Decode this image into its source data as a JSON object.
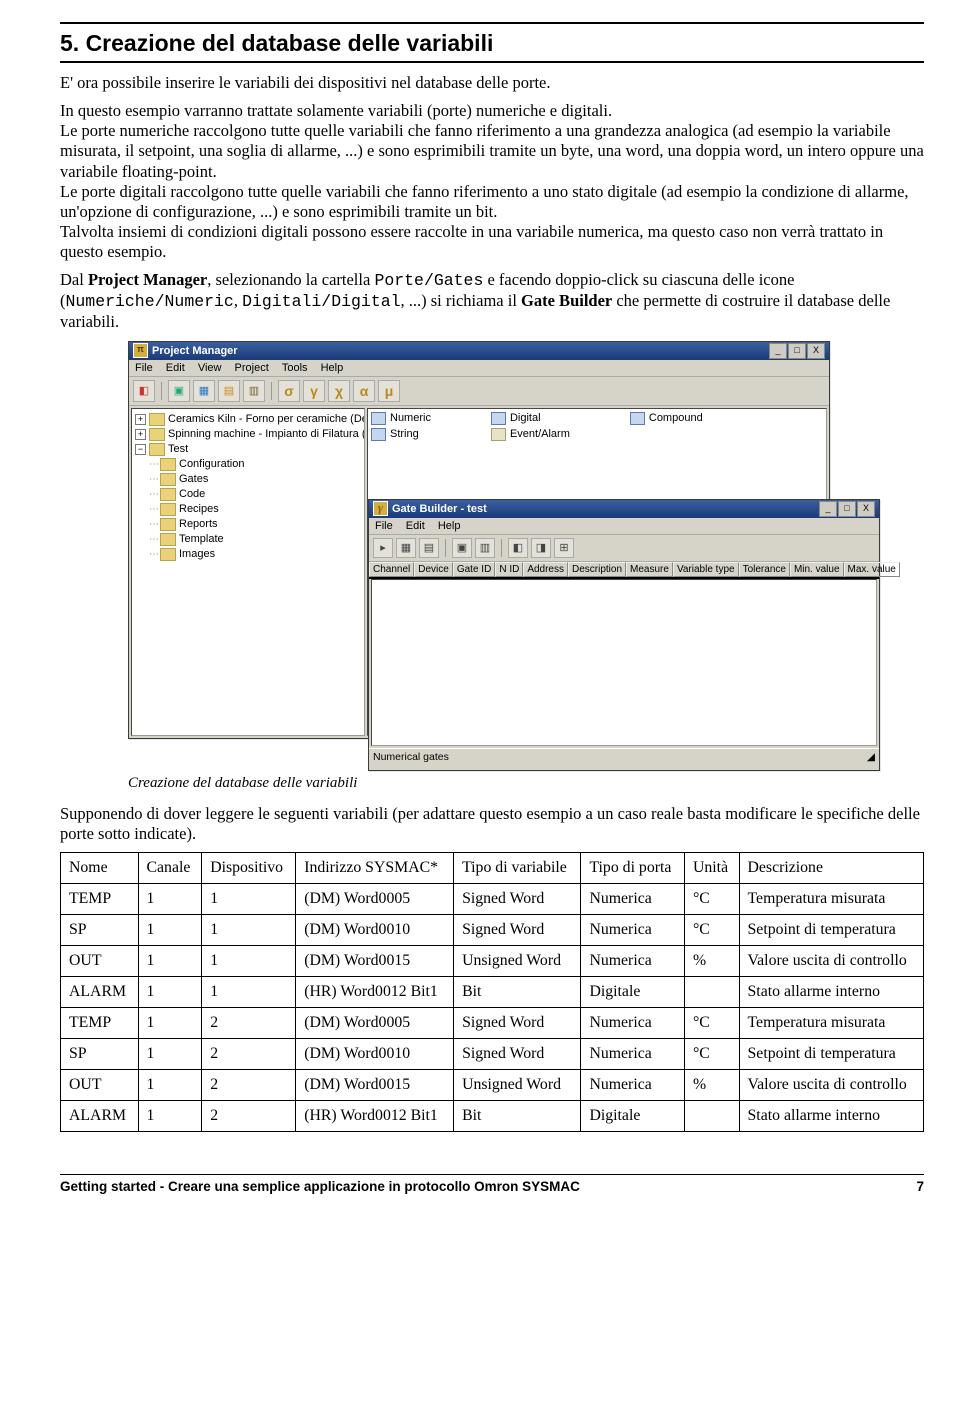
{
  "heading": "5. Creazione del database delle variabili",
  "para1": "E' ora possibile inserire le variabili dei dispositivi nel database delle porte.",
  "para2": "In questo esempio varranno trattate solamente variabili (porte) numeriche e digitali.",
  "para2b": "Le porte numeriche raccolgono tutte quelle variabili che fanno riferimento a una grandezza analogica (ad esempio la variabile misurata, il setpoint, una soglia di allarme, ...) e sono esprimibili tramite un byte, una word, una doppia word, un intero oppure una variabile floating-point.",
  "para2c": "Le porte digitali raccolgono tutte quelle variabili che fanno riferimento a uno stato digitale (ad esempio la condizione di allarme, un'opzione di configurazione, ...) e sono esprimibili tramite un bit.",
  "para2d": "Talvolta insiemi di condizioni digitali possono essere raccolte in una variabile numerica, ma questo caso non verrà trattato in questo esempio.",
  "para3a": "Dal ",
  "para3b_bold": "Project Manager",
  "para3c": ", selezionando la cartella ",
  "para3d_mono": "Porte/Gates",
  "para3e": " e facendo doppio-click su ciascuna delle icone (",
  "para3f_mono": "Numeriche/Numeric",
  "para3g": ", ",
  "para3h_mono": "Digitali/Digital",
  "para3i": ", ...) si richiama il ",
  "para3j_bold": "Gate Builder",
  "para3k": " che permette di costruire il database delle variabili.",
  "pm": {
    "icon": "π",
    "title": "Project Manager",
    "menu": [
      "File",
      "Edit",
      "View",
      "Project",
      "Tools",
      "Help"
    ],
    "greek": [
      "σ",
      "γ",
      "χ",
      "α",
      "μ"
    ],
    "tree": [
      {
        "exp": "+",
        "label": "Ceramics Kiln - Forno per ceramiche (Demo)"
      },
      {
        "exp": "+",
        "label": "Spinning machine - Impianto di Filatura (Demo)"
      },
      {
        "exp": "−",
        "label": "Test"
      }
    ],
    "subtree": [
      "Configuration",
      "Gates",
      "Code",
      "Recipes",
      "Reports",
      "Template",
      "Images"
    ],
    "right_col1": [
      "Numeric",
      "String"
    ],
    "right_col2": [
      "Digital",
      "Event/Alarm"
    ],
    "right_col3": [
      "Compound"
    ]
  },
  "gb": {
    "icon": "γ",
    "title": "Gate Builder - test",
    "menu": [
      "File",
      "Edit",
      "Help"
    ],
    "cols": [
      "Channel",
      "Device",
      "Gate ID",
      "N ID",
      "Address",
      "Description",
      "Measure",
      "Variable type",
      "Tolerance",
      "Min. value",
      "Max. value"
    ],
    "status": "Numerical gates"
  },
  "caption": "Creazione del database delle variabili",
  "para4": "Supponendo di dover leggere le seguenti variabili (per adattare questo esempio a un caso reale basta modificare le specifiche delle porte sotto indicate).",
  "thead": [
    "Nome",
    "Canale",
    "Dispositivo",
    "Indirizzo SYSMAC*",
    "Tipo di variabile",
    "Tipo di porta",
    "Unità",
    "Descrizione"
  ],
  "rows": [
    [
      "TEMP",
      "1",
      "1",
      "(DM) Word0005",
      "Signed Word",
      "Numerica",
      "°C",
      "Temperatura misurata"
    ],
    [
      "SP",
      "1",
      "1",
      "(DM) Word0010",
      "Signed Word",
      "Numerica",
      "°C",
      "Setpoint di temperatura"
    ],
    [
      "OUT",
      "1",
      "1",
      "(DM) Word0015",
      "Unsigned Word",
      "Numerica",
      "%",
      "Valore uscita di controllo"
    ],
    [
      "ALARM",
      "1",
      "1",
      "(HR) Word0012 Bit1",
      "Bit",
      "Digitale",
      "",
      "Stato allarme interno"
    ],
    [
      "TEMP",
      "1",
      "2",
      "(DM) Word0005",
      "Signed Word",
      "Numerica",
      "°C",
      "Temperatura misurata"
    ],
    [
      "SP",
      "1",
      "2",
      "(DM) Word0010",
      "Signed Word",
      "Numerica",
      "°C",
      "Setpoint di temperatura"
    ],
    [
      "OUT",
      "1",
      "2",
      "(DM) Word0015",
      "Unsigned Word",
      "Numerica",
      "%",
      "Valore uscita di controllo"
    ],
    [
      "ALARM",
      "1",
      "2",
      "(HR) Word0012 Bit1",
      "Bit",
      "Digitale",
      "",
      "Stato allarme interno"
    ]
  ],
  "footer_left": "Getting started - Creare una semplice applicazione in protocollo Omron SYSMAC",
  "footer_right": "7"
}
